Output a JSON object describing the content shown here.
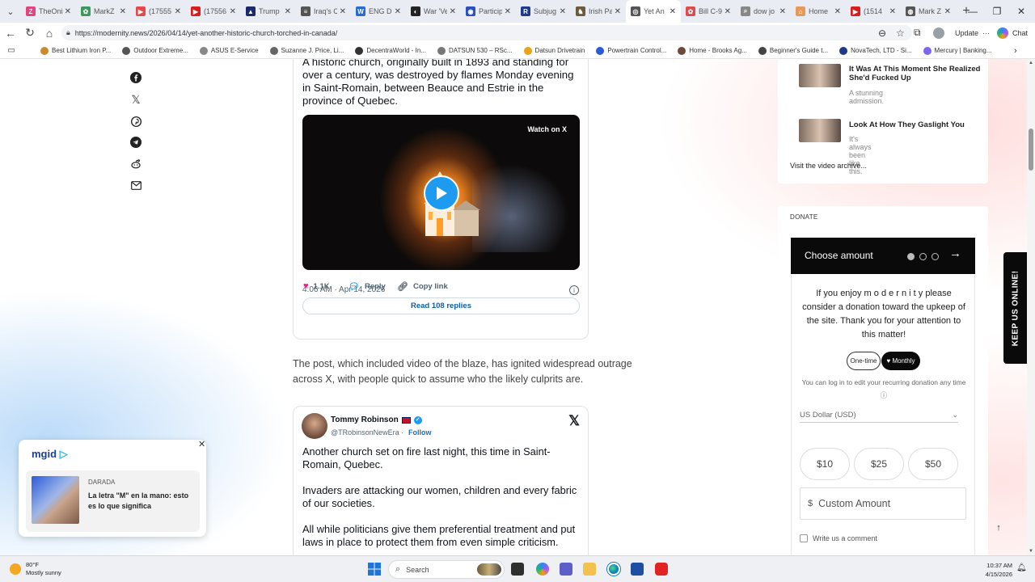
{
  "browser": {
    "tabs": [
      {
        "label": "TheOni",
        "color": "#e0457b",
        "glyph": "Z"
      },
      {
        "label": "MarkZ",
        "color": "#3a9a5b",
        "glyph": "✿"
      },
      {
        "label": "(17555",
        "color": "#e54848",
        "glyph": "▶"
      },
      {
        "label": "(17556",
        "color": "#d91c1c",
        "glyph": "▶"
      },
      {
        "label": "Trump",
        "color": "#1b2a6b",
        "glyph": "▲"
      },
      {
        "label": "Iraq's C",
        "color": "#555555",
        "glyph": "≡"
      },
      {
        "label": "ENG Di",
        "color": "#2a6bd1",
        "glyph": "W"
      },
      {
        "label": "War 'Ve",
        "color": "#222222",
        "glyph": "◐"
      },
      {
        "label": "Particip",
        "color": "#2a4fbf",
        "glyph": "◉"
      },
      {
        "label": "Subjug",
        "color": "#1e3a8a",
        "glyph": "R"
      },
      {
        "label": "Irish Pa",
        "color": "#6b5b3a",
        "glyph": "♞"
      },
      {
        "label": "Yet An",
        "color": "#555555",
        "glyph": "◎"
      },
      {
        "label": "Bill C-9",
        "color": "#d94d4d",
        "glyph": "✿"
      },
      {
        "label": "dow jo",
        "color": "#888888",
        "glyph": "⌕"
      },
      {
        "label": "Home",
        "color": "#e59a5a",
        "glyph": "⌂"
      },
      {
        "label": "(1514",
        "color": "#d91c1c",
        "glyph": "▶"
      },
      {
        "label": "Mark Z",
        "color": "#555555",
        "glyph": "◍"
      }
    ],
    "active_tab_index": 11,
    "url": "https://modernity.news/2026/04/14/yet-another-historic-church-torched-in-canada/",
    "update_label": "Update",
    "chat_label": "Chat",
    "bookmarks": [
      "Best Lithium Iron P...",
      "Outdoor Extreme...",
      "ASUS E-Service",
      "Suzanne J. Price, Li...",
      "DecentraWorld - In...",
      "DATSUN 530 – RSc...",
      "Datsun Drivetrain",
      "Powertrain Control...",
      "Home - Brooks Ag...",
      "Beginner's Guide t...",
      "NovaTech, LTD - Si...",
      "Mercury | Banking..."
    ]
  },
  "share_icons": [
    "facebook-icon",
    "x-icon",
    "pinterest-icon",
    "telegram-icon",
    "reddit-icon",
    "mail-icon"
  ],
  "tweet1": {
    "text": "A historic church, originally built in 1893 and standing for over a century, was destroyed by flames Monday evening in Saint-Romain, between Beauce and Estrie in the province of Quebec.",
    "watch_label": "Watch on X",
    "timestamp": "4:06 AM · Apr 14, 2026",
    "likes": "1.1K",
    "reply_label": "Reply",
    "copy_label": "Copy link",
    "read_replies": "Read 108 replies"
  },
  "article": {
    "paragraph": "The post, which included video of the blaze, has ignited widespread outrage across X, with people quick to assume who the likely culprits are."
  },
  "tweet2": {
    "name": "Tommy Robinson",
    "handle": "@TRobinsonNewEra",
    "follow_label": "Follow",
    "para1": "Another church set on fire last night, this time in Saint-Romain, Quebec.",
    "para2": "Invaders are attacking our women, children and every fabric of our societies.",
    "para3": "All while politicians give them preferential treatment and put laws in place to protect them from even simple criticism."
  },
  "mgid_ad": {
    "logo": "mgid",
    "source": "DARADA",
    "headline": "La letra \"M\" en la mano: esto es lo que significa"
  },
  "sidebar": {
    "videos": [
      {
        "title": "It Was At This Moment She Realized She'd Fucked Up",
        "subtitle": "A stunning admission."
      },
      {
        "title": "Look At How They Gaslight You",
        "subtitle": "It's always been like this."
      }
    ],
    "archive_link": "Visit the video archive...",
    "donate": {
      "section_label": "DONATE",
      "choose_title": "Choose amount",
      "text": "If you enjoy m o d e r n i t y please consider a donation toward the upkeep of the site. Thank you for your attention to this matter!",
      "one_time": "One-time",
      "monthly": "♥ Monthly",
      "login_note": "You can log in to edit your recurring donation any time ⓘ",
      "currency": "US Dollar (USD)",
      "amounts": [
        "$10",
        "$25",
        "$50"
      ],
      "custom_placeholder": "Custom Amount",
      "comment_label": "Write us a comment"
    },
    "keep_us_online": "KEEP US ONLINE!"
  },
  "taskbar": {
    "temperature": "80°F",
    "weather": "Mostly sunny",
    "search_label": "Search",
    "time": "10:37 AM",
    "date": "4/15/2026"
  }
}
